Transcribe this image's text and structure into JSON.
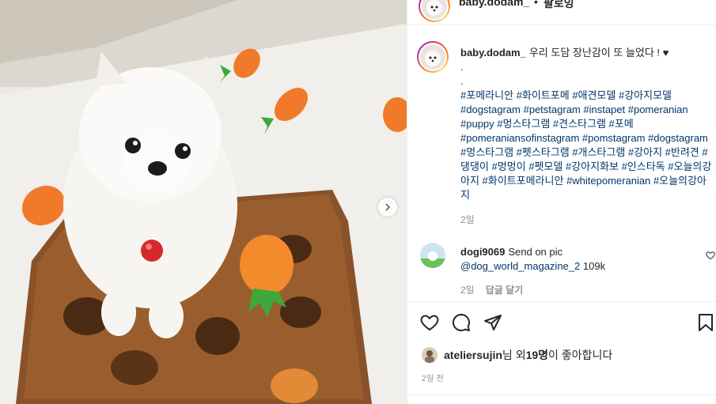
{
  "header": {
    "username": "baby.dodam_",
    "separator": "•",
    "follow_label": "팔로잉",
    "more_label": "•••"
  },
  "caption": {
    "author": "baby.dodam_",
    "text": "우리 도담 장난감이 또 늘었다 ! ♥",
    "dot1": ".",
    "dot2": ".",
    "hashtags": "#포메라니안 #화이트포메 #애견모델 #강아지모델 #dogstagram #petstagram #instapet #pomeranian #puppy #멍스타그램 #견스타그램 #포메 #pomeraniansofinstagram #pomstagram #dogstagram #멍스타그램 #펫스타그램 #개스타그램 #강아지 #반려견 #댕댕이 #멍멍이 #펫모델 #강아지화보 #인스타독 #오늘의강아지 #화이트포메라니안 #whitepomeranian #오늘의강아지",
    "age": "2일"
  },
  "comment": {
    "author": "dogi9069",
    "text": "Send on pic",
    "mention": "@dog_world_magazine_2",
    "count": "109k",
    "age": "2일",
    "reply_label": "답글 달기"
  },
  "likes": {
    "user": "ateliersujin",
    "suffix_pre": "님 외 ",
    "count": "19명",
    "suffix_post": "이 좋아합니다"
  },
  "post_time": "2일 전",
  "colors": {
    "link": "#00376b",
    "muted": "#8e8e8e",
    "border": "#efefef",
    "carrot": "#f07a2a",
    "leaf": "#3ea83a",
    "mat": "#8a5228"
  },
  "icons": [
    "more-icon",
    "next-arrow-icon",
    "heart-icon",
    "comment-icon",
    "share-icon",
    "bookmark-icon",
    "small-heart-icon"
  ]
}
